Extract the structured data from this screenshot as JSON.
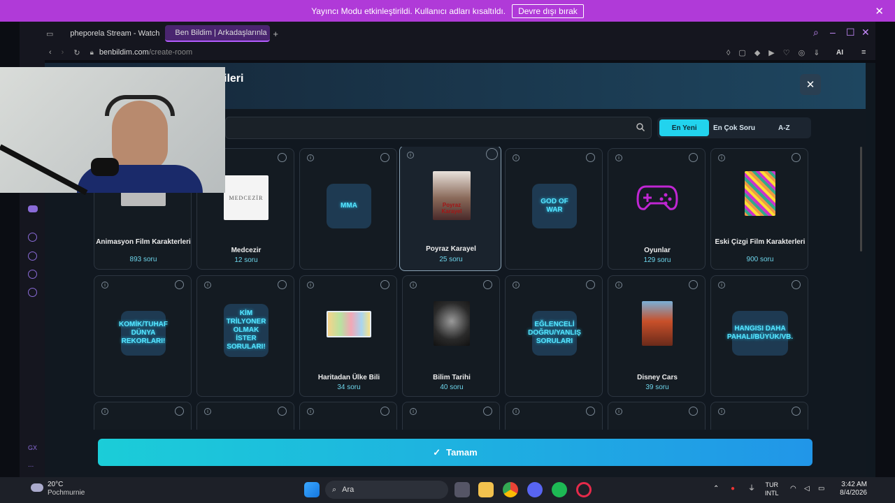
{
  "notification": {
    "text": "Yayıncı Modu etkinleştirildi. Kullanıcı adları kısaltıldı.",
    "button": "Devre dışı bırak"
  },
  "browser": {
    "tabs": [
      {
        "label": "pheporela Stream - Watch"
      },
      {
        "label": "Ben Bildim | Arkadaşlarınla"
      }
    ],
    "url_host": "benbildim.com",
    "url_path": "/create-room",
    "ai_label": "AI"
  },
  "modal": {
    "title_fragment": "ileri",
    "close": "✕",
    "search_placeholder": "",
    "sort": [
      "En Yeni",
      "En Çok Soru",
      "A-Z"
    ],
    "confirm": "Tamam",
    "confirm_icon": "✓"
  },
  "cards": [
    {
      "name": "Animasyon Film Karakterleri",
      "count": "893 soru"
    },
    {
      "name": "Medcezir",
      "count": "12 soru",
      "logo": "MEDCEZİR"
    },
    {
      "glow": "MMA"
    },
    {
      "name": "Poyraz Karayel",
      "count": "25 soru",
      "poster": "Poyraz Karayel"
    },
    {
      "glow": "GOD OF WAR"
    },
    {
      "name": "Oyunlar",
      "count": "129 soru"
    },
    {
      "name": "Eski Çizgi Film Karakterleri",
      "count": "900 soru"
    },
    {
      "glow": "KOMİK/TUHAF DÜNYA REKORLARI!"
    },
    {
      "glow": "KİM TRİLYONER OLMAK İSTER SORULARI!"
    },
    {
      "name": "Haritadan Ülke Bili",
      "count": "34 soru"
    },
    {
      "name": "Bilim Tarihi",
      "count": "40 soru"
    },
    {
      "glow": "EĞLENCELİ DOĞRU/YANLIŞ SORULARI"
    },
    {
      "name": "Disney Cars",
      "count": "39 soru"
    },
    {
      "glow": "HANGISI DAHA PAHALI/BÜYÜK/VB."
    }
  ],
  "taskbar": {
    "weather_temp": "20°C",
    "weather_desc": "Pochmurnie",
    "search": "Ara",
    "lang1": "TUR",
    "lang2": "INTL",
    "time": "3:42 AM",
    "date": "8/4/2026"
  },
  "sidebar": {
    "gx": "GX",
    "more": "..."
  },
  "colors": {
    "accent": "#22d3ee",
    "notification": "#b03ad8",
    "opera": "#b45cff"
  }
}
